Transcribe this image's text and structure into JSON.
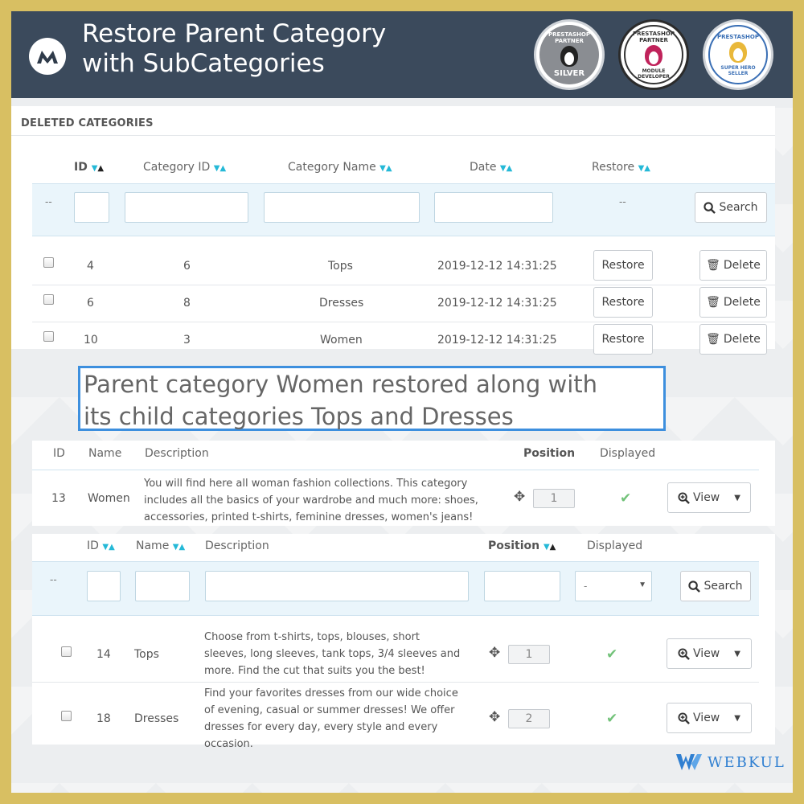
{
  "header": {
    "title_line1": "Restore Parent Category",
    "title_line2": "with SubCategories",
    "badges": [
      {
        "top": "PRESTASHOP PARTNER",
        "bottom": "SILVER",
        "color": "#8a8d92"
      },
      {
        "top": "PRESTASHOP PARTNER",
        "bottom": "MODULE DEVELOPER",
        "color": "#ffffff"
      },
      {
        "top": "PRESTASHOP",
        "bottom": "SUPER HERO SELLER",
        "color": "#ffffff"
      }
    ]
  },
  "deleted": {
    "heading": "DELETED CATEGORIES",
    "columns": {
      "id": "ID",
      "category_id": "Category ID",
      "category_name": "Category Name",
      "date": "Date",
      "restore": "Restore"
    },
    "filter_dash": "--",
    "restore_dash": "--",
    "search_label": "Search",
    "rows": [
      {
        "id": "4",
        "category_id": "6",
        "name": "Tops",
        "date": "2019-12-12 14:31:25",
        "restore_label": "Restore",
        "delete_label": "Delete"
      },
      {
        "id": "6",
        "category_id": "8",
        "name": "Dresses",
        "date": "2019-12-12 14:31:25",
        "restore_label": "Restore",
        "delete_label": "Delete"
      },
      {
        "id": "10",
        "category_id": "3",
        "name": "Women",
        "date": "2019-12-12 14:31:25",
        "restore_label": "Restore",
        "delete_label": "Delete"
      }
    ]
  },
  "callout": {
    "line1": "Parent category Women restored along with",
    "line2": "its child categories Tops and Dresses"
  },
  "parent": {
    "columns": {
      "id": "ID",
      "name": "Name",
      "description": "Description",
      "position": "Position",
      "displayed": "Displayed"
    },
    "row": {
      "id": "13",
      "name": "Women",
      "desc1": "You will find here all woman fashion collections. This category",
      "desc2": "includes all the basics of your wardrobe and much more: shoes,",
      "desc3": "accessories, printed t-shirts, feminine dresses, women's jeans!",
      "position": "1",
      "view_label": "View"
    }
  },
  "children": {
    "columns": {
      "id": "ID",
      "name": "Name",
      "description": "Description",
      "position": "Position",
      "displayed": "Displayed"
    },
    "filter_dash": "--",
    "select_value": "-",
    "search_label": "Search",
    "rows": [
      {
        "id": "14",
        "name": "Tops",
        "desc1": "Choose from t-shirts, tops, blouses, short",
        "desc2": "sleeves, long sleeves, tank tops, 3/4 sleeves and",
        "desc3": "more. Find the cut that suits you the best!",
        "desc4": "",
        "position": "1",
        "view_label": "View"
      },
      {
        "id": "18",
        "name": "Dresses",
        "desc1": "Find your favorites dresses from our wide choice",
        "desc2": "of evening, casual or summer dresses! We offer",
        "desc3": "dresses for every day, every style and every",
        "desc4": "occasion.",
        "position": "2",
        "view_label": "View"
      }
    ]
  },
  "footer": {
    "brand": "WEBKUL"
  }
}
